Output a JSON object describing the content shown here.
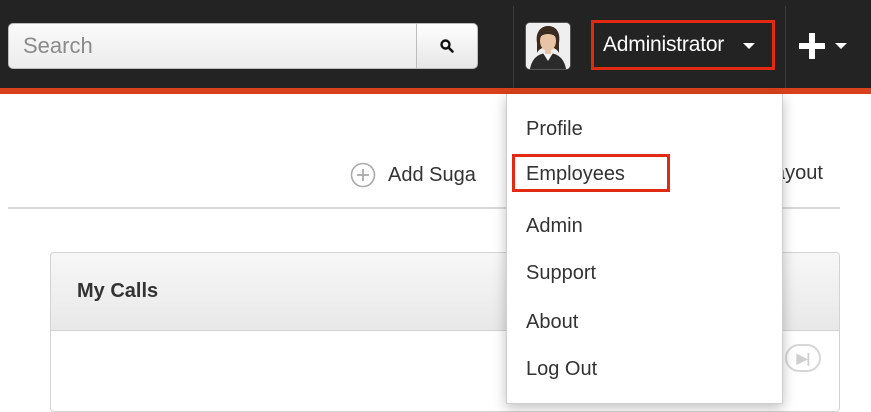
{
  "header": {
    "search": {
      "placeholder": "Search",
      "value": ""
    },
    "user": {
      "name": "Administrator"
    },
    "icons": {
      "search": "search-icon",
      "user_caret": "chevron-down-icon",
      "plus": "plus-icon",
      "plus_caret": "chevron-down-icon"
    },
    "colors": {
      "bar": "#232323",
      "accent": "#d9411c",
      "highlight": "#e02b12"
    }
  },
  "dashboard": {
    "add_sugar_label": "Add Suga",
    "layout_label": "ayout",
    "dashlet": {
      "title": "My Calls"
    }
  },
  "user_menu": {
    "items": [
      {
        "label": "Profile"
      },
      {
        "label": "Employees",
        "highlighted": true
      },
      {
        "label": "Admin"
      },
      {
        "label": "Support"
      },
      {
        "label": "About"
      },
      {
        "label": "Log Out"
      }
    ]
  }
}
